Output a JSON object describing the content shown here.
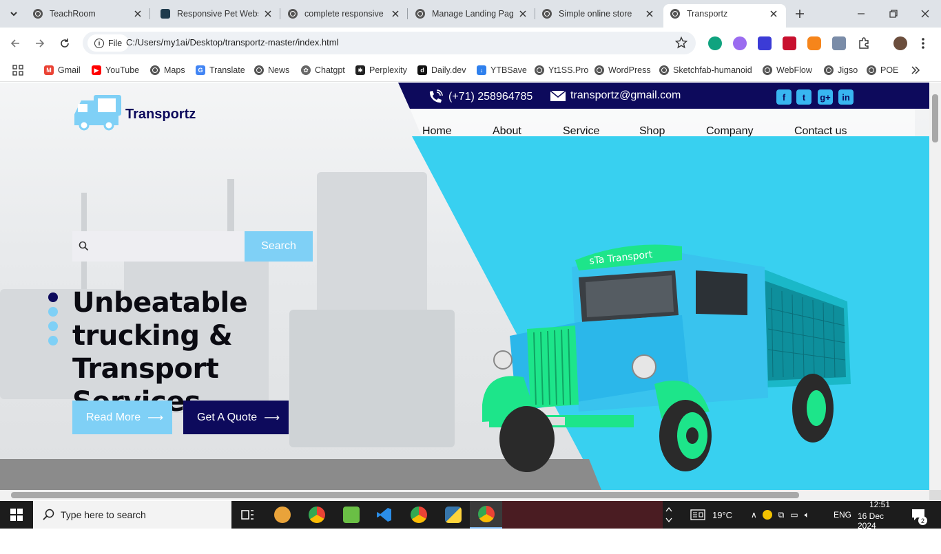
{
  "browser": {
    "tabs": [
      {
        "label": "TeachRoom",
        "active": false
      },
      {
        "label": "Responsive Pet Websi",
        "active": false
      },
      {
        "label": "complete responsive",
        "active": false
      },
      {
        "label": "Manage Landing Pag",
        "active": false
      },
      {
        "label": "Simple online store",
        "active": false
      },
      {
        "label": "Transportz",
        "active": true
      }
    ],
    "omnibox": {
      "scheme_label": "File",
      "url": "C:/Users/my1ai/Desktop/transportz-master/index.html"
    },
    "bookmarks": [
      "Gmail",
      "YouTube",
      "Maps",
      "Translate",
      "News",
      "Chatgpt",
      "Perplexity",
      "Daily.dev",
      "YTBSave",
      "Yt1SS.Pro",
      "WordPress",
      "Sketchfab-humanoid",
      "WebFlow",
      "Jigso",
      "POE"
    ]
  },
  "site": {
    "brand": "Transportz",
    "phone": "(+71) 258964785",
    "email": "transportz@gmail.com",
    "social": [
      "f",
      "t",
      "g+",
      "in"
    ],
    "menu": [
      "Home",
      "About",
      "Service",
      "Shop",
      "Company",
      "Contact us"
    ],
    "search": {
      "placeholder": "",
      "button": "Search"
    },
    "headline_lines": [
      "Unbeatable",
      "trucking & Transport",
      "Services"
    ],
    "read_more": "Read More",
    "get_quote": "Get A Quote",
    "truck_sign": "sTa Transport",
    "slider": {
      "count": 4,
      "active_index": 0
    },
    "colors": {
      "navy": "#0d0a5c",
      "cyan": "#38d0f0",
      "light_blue": "#7fd0f6",
      "green": "#1de58a"
    }
  },
  "taskbar": {
    "search_placeholder": "Type here to search",
    "weather": "19°C",
    "language": "ENG",
    "time": "12:51",
    "date": "16 Dec 2024",
    "notifications": "2"
  }
}
